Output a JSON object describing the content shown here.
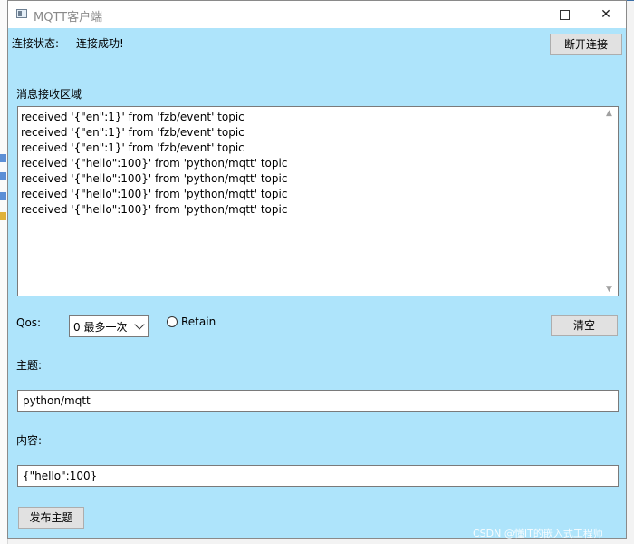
{
  "window": {
    "title": "MQTT客户端",
    "minimize_glyph": "",
    "close_glyph": "✕"
  },
  "connection": {
    "status_label": "连接状态:",
    "status_value": "连接成功!",
    "disconnect_button": "断开连接"
  },
  "receive": {
    "area_label": "消息接收区域",
    "messages": [
      "received '{\"en\":1}' from 'fzb/event' topic",
      "received '{\"en\":1}' from 'fzb/event' topic",
      "received '{\"en\":1}' from 'fzb/event' topic",
      "received '{\"hello\":100}' from 'python/mqtt' topic",
      "received '{\"hello\":100}' from 'python/mqtt' topic",
      "received '{\"hello\":100}' from 'python/mqtt' topic",
      "received '{\"hello\":100}' from 'python/mqtt' topic"
    ]
  },
  "options": {
    "qos_label": "Qos:",
    "qos_value": "0 最多一次",
    "retain_label": "Retain",
    "retain_checked": false,
    "clear_button": "清空"
  },
  "publish": {
    "topic_label": "主题:",
    "topic_value": "python/mqtt",
    "content_label": "内容:",
    "content_value": "{\"hello\":100}",
    "publish_button": "发布主题"
  },
  "watermark": "CSDN @懂IT的嵌入式工程师",
  "colors": {
    "window_bg": "#aee4fb",
    "titlebar_bg": "#ffffff"
  }
}
